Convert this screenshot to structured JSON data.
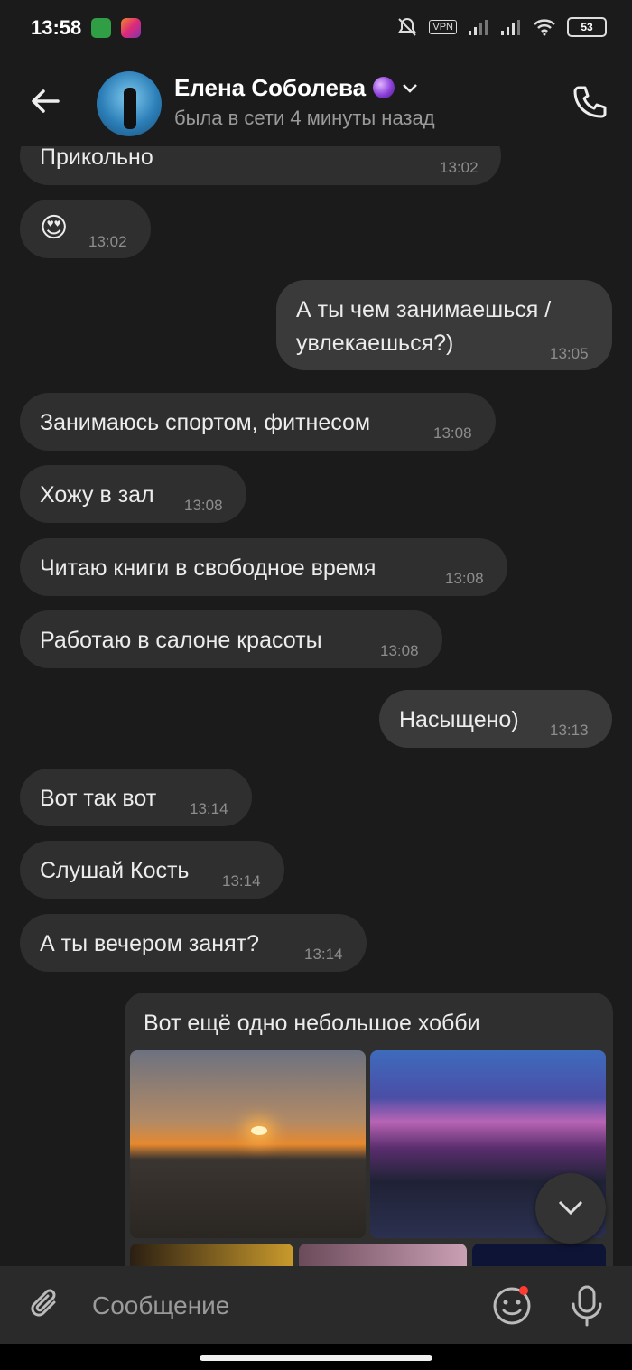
{
  "status_bar": {
    "time": "13:58",
    "vpn": "VPN",
    "battery": "53"
  },
  "header": {
    "name": "Елена Соболева",
    "status": "была в сети 4 минуты назад"
  },
  "messages": [
    {
      "text": "Прикольно",
      "time": "13:02",
      "dir": "in"
    },
    {
      "text": "😍",
      "time": "13:02",
      "dir": "in"
    },
    {
      "text_line1": "А ты чем занимаешься /",
      "text_line2": "увлекаешься?)",
      "time": "13:05",
      "dir": "out"
    },
    {
      "text": "Занимаюсь спортом, фитнесом",
      "time": "13:08",
      "dir": "in"
    },
    {
      "text": "Хожу в зал",
      "time": "13:08",
      "dir": "in"
    },
    {
      "text": "Читаю книги в свободное время",
      "time": "13:08",
      "dir": "in"
    },
    {
      "text": "Работаю в салоне красоты",
      "time": "13:08",
      "dir": "in"
    },
    {
      "text": "Насыщено)",
      "time": "13:13",
      "dir": "out"
    },
    {
      "text": "Вот так вот",
      "time": "13:14",
      "dir": "in"
    },
    {
      "text": "Слушай Кость",
      "time": "13:14",
      "dir": "in"
    },
    {
      "text": "А ты вечером занят?",
      "time": "13:14",
      "dir": "in"
    }
  ],
  "photo_message": {
    "caption": "Вот ещё одно небольшое хобби"
  },
  "input": {
    "placeholder": "Сообщение"
  },
  "colors": {
    "background": "#1b1b1b",
    "bubble_in": "#2f2f2f",
    "bubble_out": "#3a3a3a",
    "notification_dot": "#ff3b30"
  }
}
